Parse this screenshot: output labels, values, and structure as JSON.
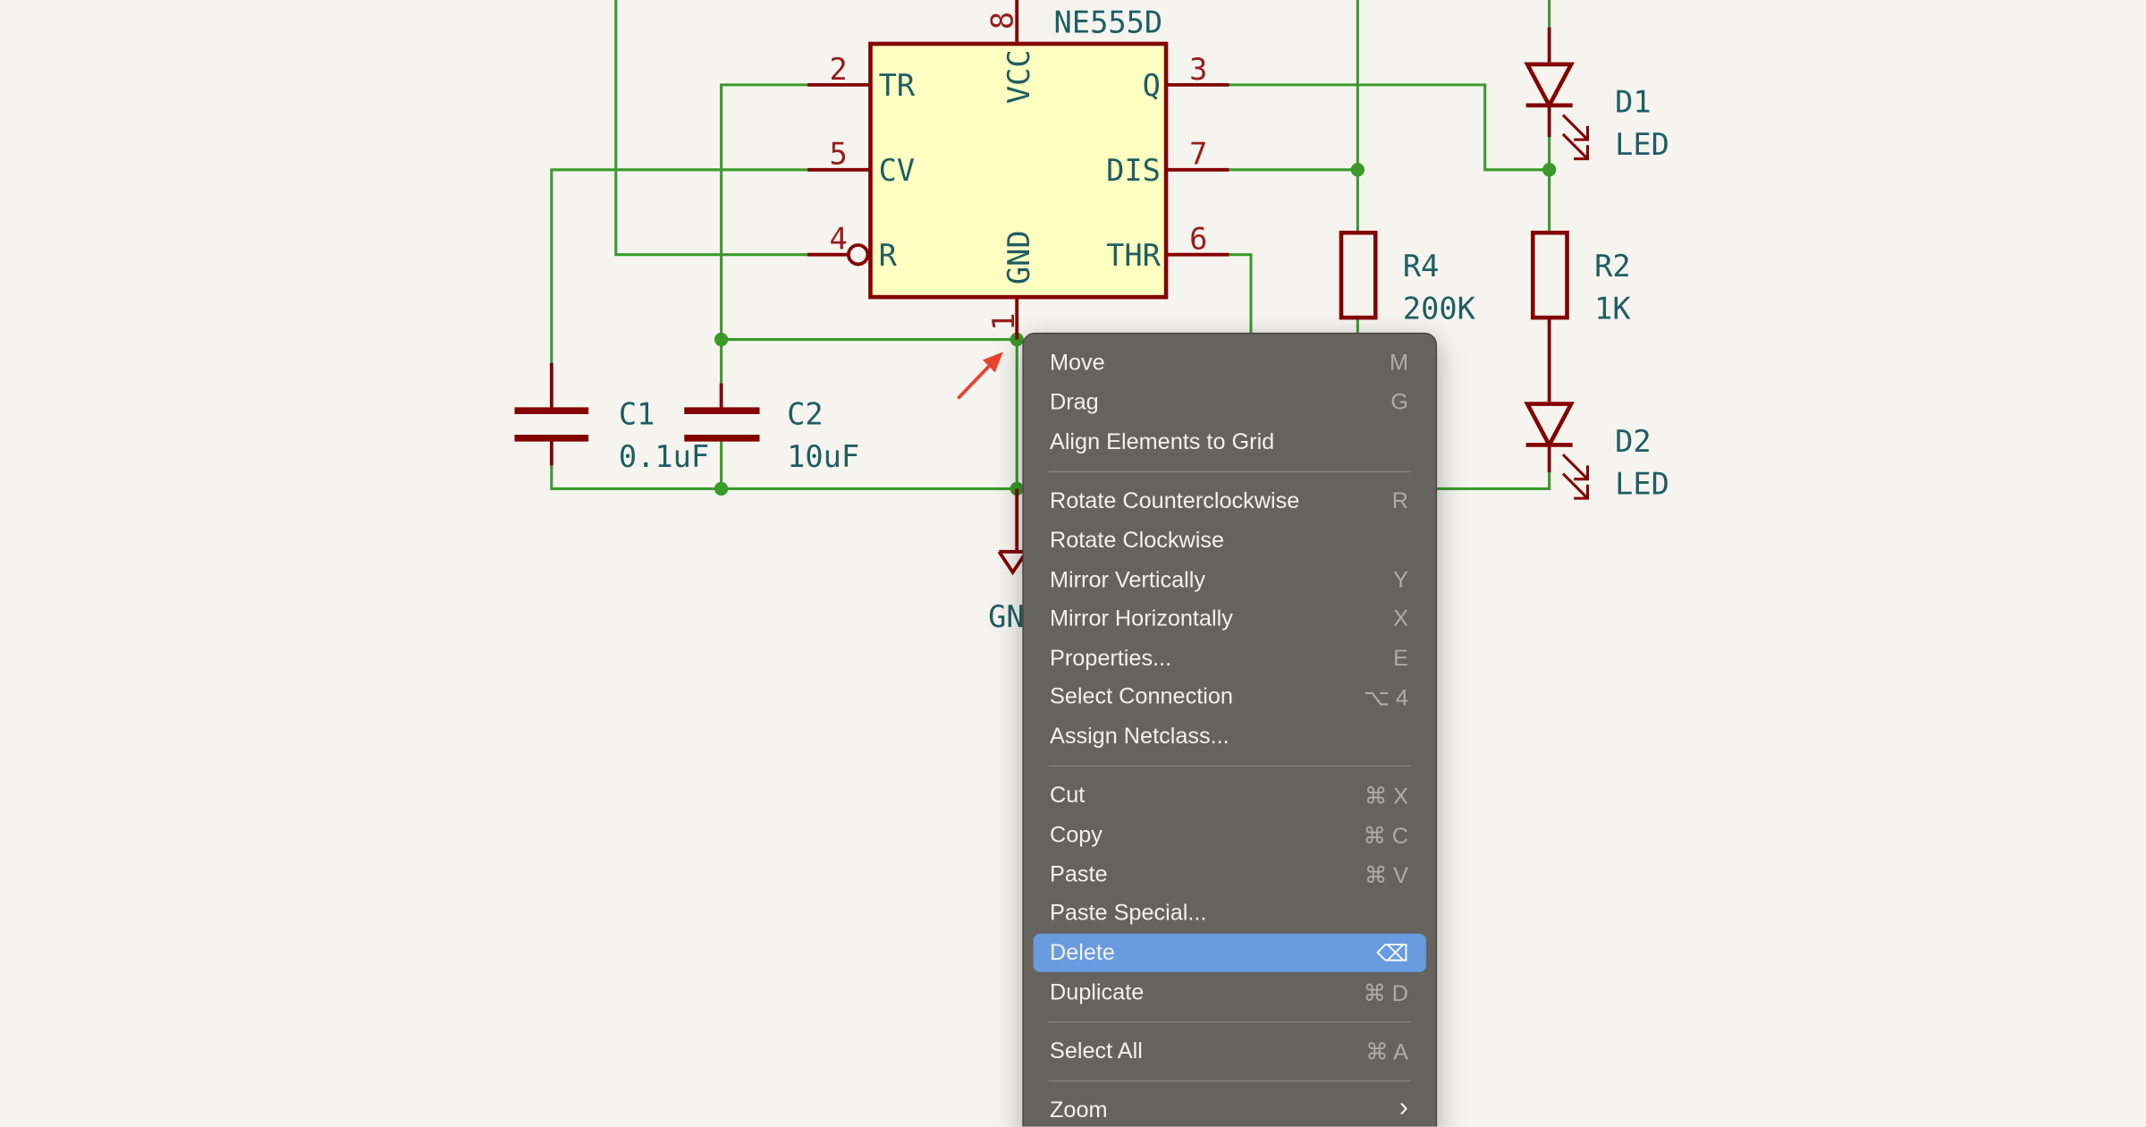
{
  "schematic": {
    "chip": {
      "ref": "NE555D",
      "pins": [
        {
          "num": "8",
          "name": "VCC"
        },
        {
          "num": "2",
          "name": "TR"
        },
        {
          "num": "5",
          "name": "CV"
        },
        {
          "num": "4",
          "name": "R"
        },
        {
          "num": "1",
          "name": "GND"
        },
        {
          "num": "3",
          "name": "Q"
        },
        {
          "num": "7",
          "name": "DIS"
        },
        {
          "num": "6",
          "name": "THR"
        }
      ]
    },
    "c1": {
      "ref": "C1",
      "value": "0.1uF"
    },
    "c2": {
      "ref": "C2",
      "value": "10uF"
    },
    "r4": {
      "ref": "R4",
      "value": "200K"
    },
    "r2": {
      "ref": "R2",
      "value": "1K"
    },
    "d1": {
      "ref": "D1",
      "value": "LED"
    },
    "d2": {
      "ref": "D2",
      "value": "LED"
    },
    "gnd_label": "GN",
    "colors": {
      "wire": "#3a9a2a",
      "component": "#840000",
      "chip_fill": "#ffffc2",
      "text": "#1f5d63",
      "arrow": "#e8432d"
    }
  },
  "context_menu": {
    "items": [
      {
        "label": "Move",
        "shortcut": "M"
      },
      {
        "label": "Drag",
        "shortcut": "G"
      },
      {
        "label": "Align Elements to Grid",
        "shortcut": ""
      },
      {
        "label": "Rotate Counterclockwise",
        "shortcut": "R"
      },
      {
        "label": "Rotate Clockwise",
        "shortcut": ""
      },
      {
        "label": "Mirror Vertically",
        "shortcut": "Y"
      },
      {
        "label": "Mirror Horizontally",
        "shortcut": "X"
      },
      {
        "label": "Properties...",
        "shortcut": "E"
      },
      {
        "label": "Select Connection",
        "shortcut": "⌥ 4"
      },
      {
        "label": "Assign Netclass...",
        "shortcut": ""
      },
      {
        "label": "Cut",
        "shortcut": "⌘ X"
      },
      {
        "label": "Copy",
        "shortcut": "⌘ C"
      },
      {
        "label": "Paste",
        "shortcut": "⌘ V"
      },
      {
        "label": "Paste Special...",
        "shortcut": ""
      },
      {
        "label": "Delete",
        "shortcut": "⌫",
        "highlighted": true
      },
      {
        "label": "Duplicate",
        "shortcut": "⌘ D"
      },
      {
        "label": "Select All",
        "shortcut": "⌘ A"
      },
      {
        "label": "Zoom",
        "shortcut": "›"
      }
    ],
    "highlight_color": "#699be0"
  }
}
